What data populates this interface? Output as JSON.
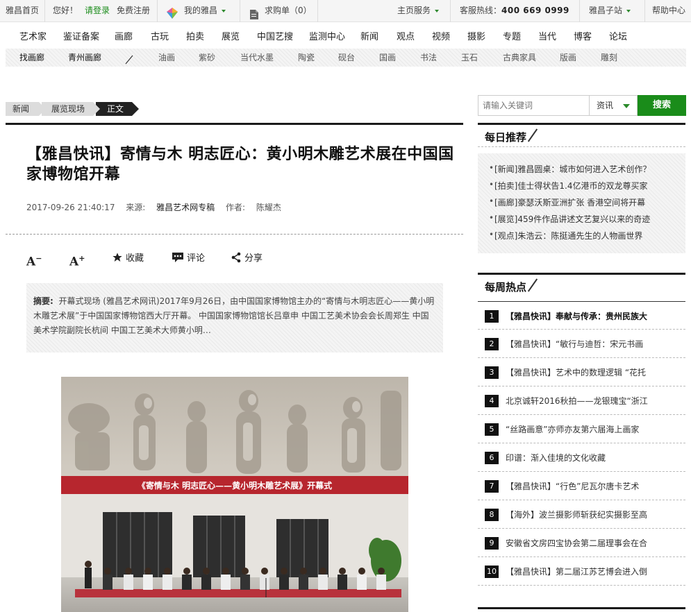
{
  "topbar": {
    "home": "雅昌首页",
    "hello": "您好！",
    "login": "请登录",
    "register": "免费注册",
    "my_artron": "我的雅昌",
    "wishlist": "求购单（0）",
    "main_service": "主页服务",
    "hotline_label": "客服热线：",
    "hotline_number": "400 669 0999",
    "substation": "雅昌子站",
    "help": "帮助中心"
  },
  "nav": {
    "main": [
      "艺术家",
      "鉴证备案",
      "画廊",
      "古玩",
      "拍卖",
      "展览",
      "中国艺搜",
      "监测中心",
      "新闻",
      "观点",
      "视频",
      "摄影",
      "专题",
      "当代",
      "博客",
      "论坛"
    ],
    "sub_left": [
      "找画廊",
      "青州画廊"
    ],
    "sub": [
      "油画",
      "紫砂",
      "当代水墨",
      "陶瓷",
      "砚台",
      "国画",
      "书法",
      "玉石",
      "古典家具",
      "版画",
      "雕刻"
    ]
  },
  "breadcrumb": [
    "新闻",
    "展览现场",
    "正文"
  ],
  "article": {
    "title": "【雅昌快讯】寄情与木 明志匠心：黄小明木雕艺术展在中国国家博物馆开幕",
    "date": "2017-09-26 21:40:17",
    "source_label": "来源:",
    "source": "雅昌艺术网专稿",
    "author_label": "作者:",
    "author": "陈耀杰",
    "tools": {
      "font_down": "A",
      "font_up": "A",
      "favorite": "收藏",
      "comment": "评论",
      "share": "分享"
    },
    "abstract_label": "摘要:",
    "abstract": "开幕式现场 (雅昌艺术网讯)2017年9月26日，由中国国家博物馆主办的“寄情与木明志匠心——黄小明木雕艺术展”于中国国家博物馆西大厅开幕。 中国国家博物馆馆长吕章申 中国工艺美术协会会长周郑生 中国美术学院副院长杭间 中国工艺美术大师黄小明…",
    "banner_text": "《寄情与木 明志匠心——黄小明木雕艺术展》开幕式"
  },
  "search": {
    "placeholder": "请输入关键词",
    "category": "资讯",
    "button": "搜索"
  },
  "daily": {
    "title": "每日推荐",
    "items": [
      "[新闻]雅昌圆桌：城市如何进入艺术创作？",
      "[拍卖]佳士得状告1.4亿港币的双龙尊买家",
      "[画廊]豪瑟沃斯亚洲扩张 香港空间将开幕",
      "[展览]459件作品讲述文艺复兴以来的奇迹",
      "[观点]朱浩云：陈挺通先生的人物画世界"
    ]
  },
  "weekly": {
    "title": "每周热点",
    "items": [
      {
        "num": "1",
        "text": "【雅昌快讯】奉献与传承：贵州民族大"
      },
      {
        "num": "2",
        "text": "【雅昌快讯】“敏行与迪哲：宋元书画"
      },
      {
        "num": "3",
        "text": "【雅昌快讯】艺术中的数理逻辑 “花托"
      },
      {
        "num": "4",
        "text": "北京诚轩2016秋拍——龙银瑰宝“浙江"
      },
      {
        "num": "5",
        "text": "“丝路画意”亦师亦友第六届海上画家"
      },
      {
        "num": "6",
        "text": "印谱：渐入佳境的文化收藏"
      },
      {
        "num": "7",
        "text": "【雅昌快讯】“行色”尼瓦尔唐卡艺术"
      },
      {
        "num": "8",
        "text": "【海外】波兰摄影师斩获纪实摄影至高"
      },
      {
        "num": "9",
        "text": "安徽省文房四宝协会第二届理事会在合"
      },
      {
        "num": "10",
        "text": "【雅昌快讯】第二届江苏艺博会进入倒"
      }
    ]
  },
  "colors": {
    "accent_green": "#1a8c1a",
    "dark": "#1a1a1a",
    "banner_red": "#b7262e"
  }
}
